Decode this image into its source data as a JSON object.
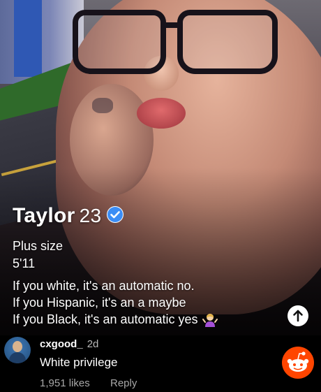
{
  "profile": {
    "name": "Taylor",
    "age": "23",
    "verified_icon": "verified-check-icon",
    "accent_color": "#3b8df5"
  },
  "bio": {
    "line1": "Plus size",
    "line2": "5'11",
    "line3": "If you white, it's an automatic no.",
    "line4": "If you Hispanic, it's an a maybe",
    "line5": "If you Black, it's an automatic yes",
    "emoji_icon": "shrug-woman-emoji-icon"
  },
  "actions": {
    "up_arrow_icon": "up-arrow-icon"
  },
  "comment": {
    "username": "cxgood_",
    "time": "2d",
    "text": "White privilege",
    "likes": "1,951 likes",
    "reply_label": "Reply",
    "badge_icon": "reddit-snoo-icon",
    "badge_color": "#ff4500"
  }
}
